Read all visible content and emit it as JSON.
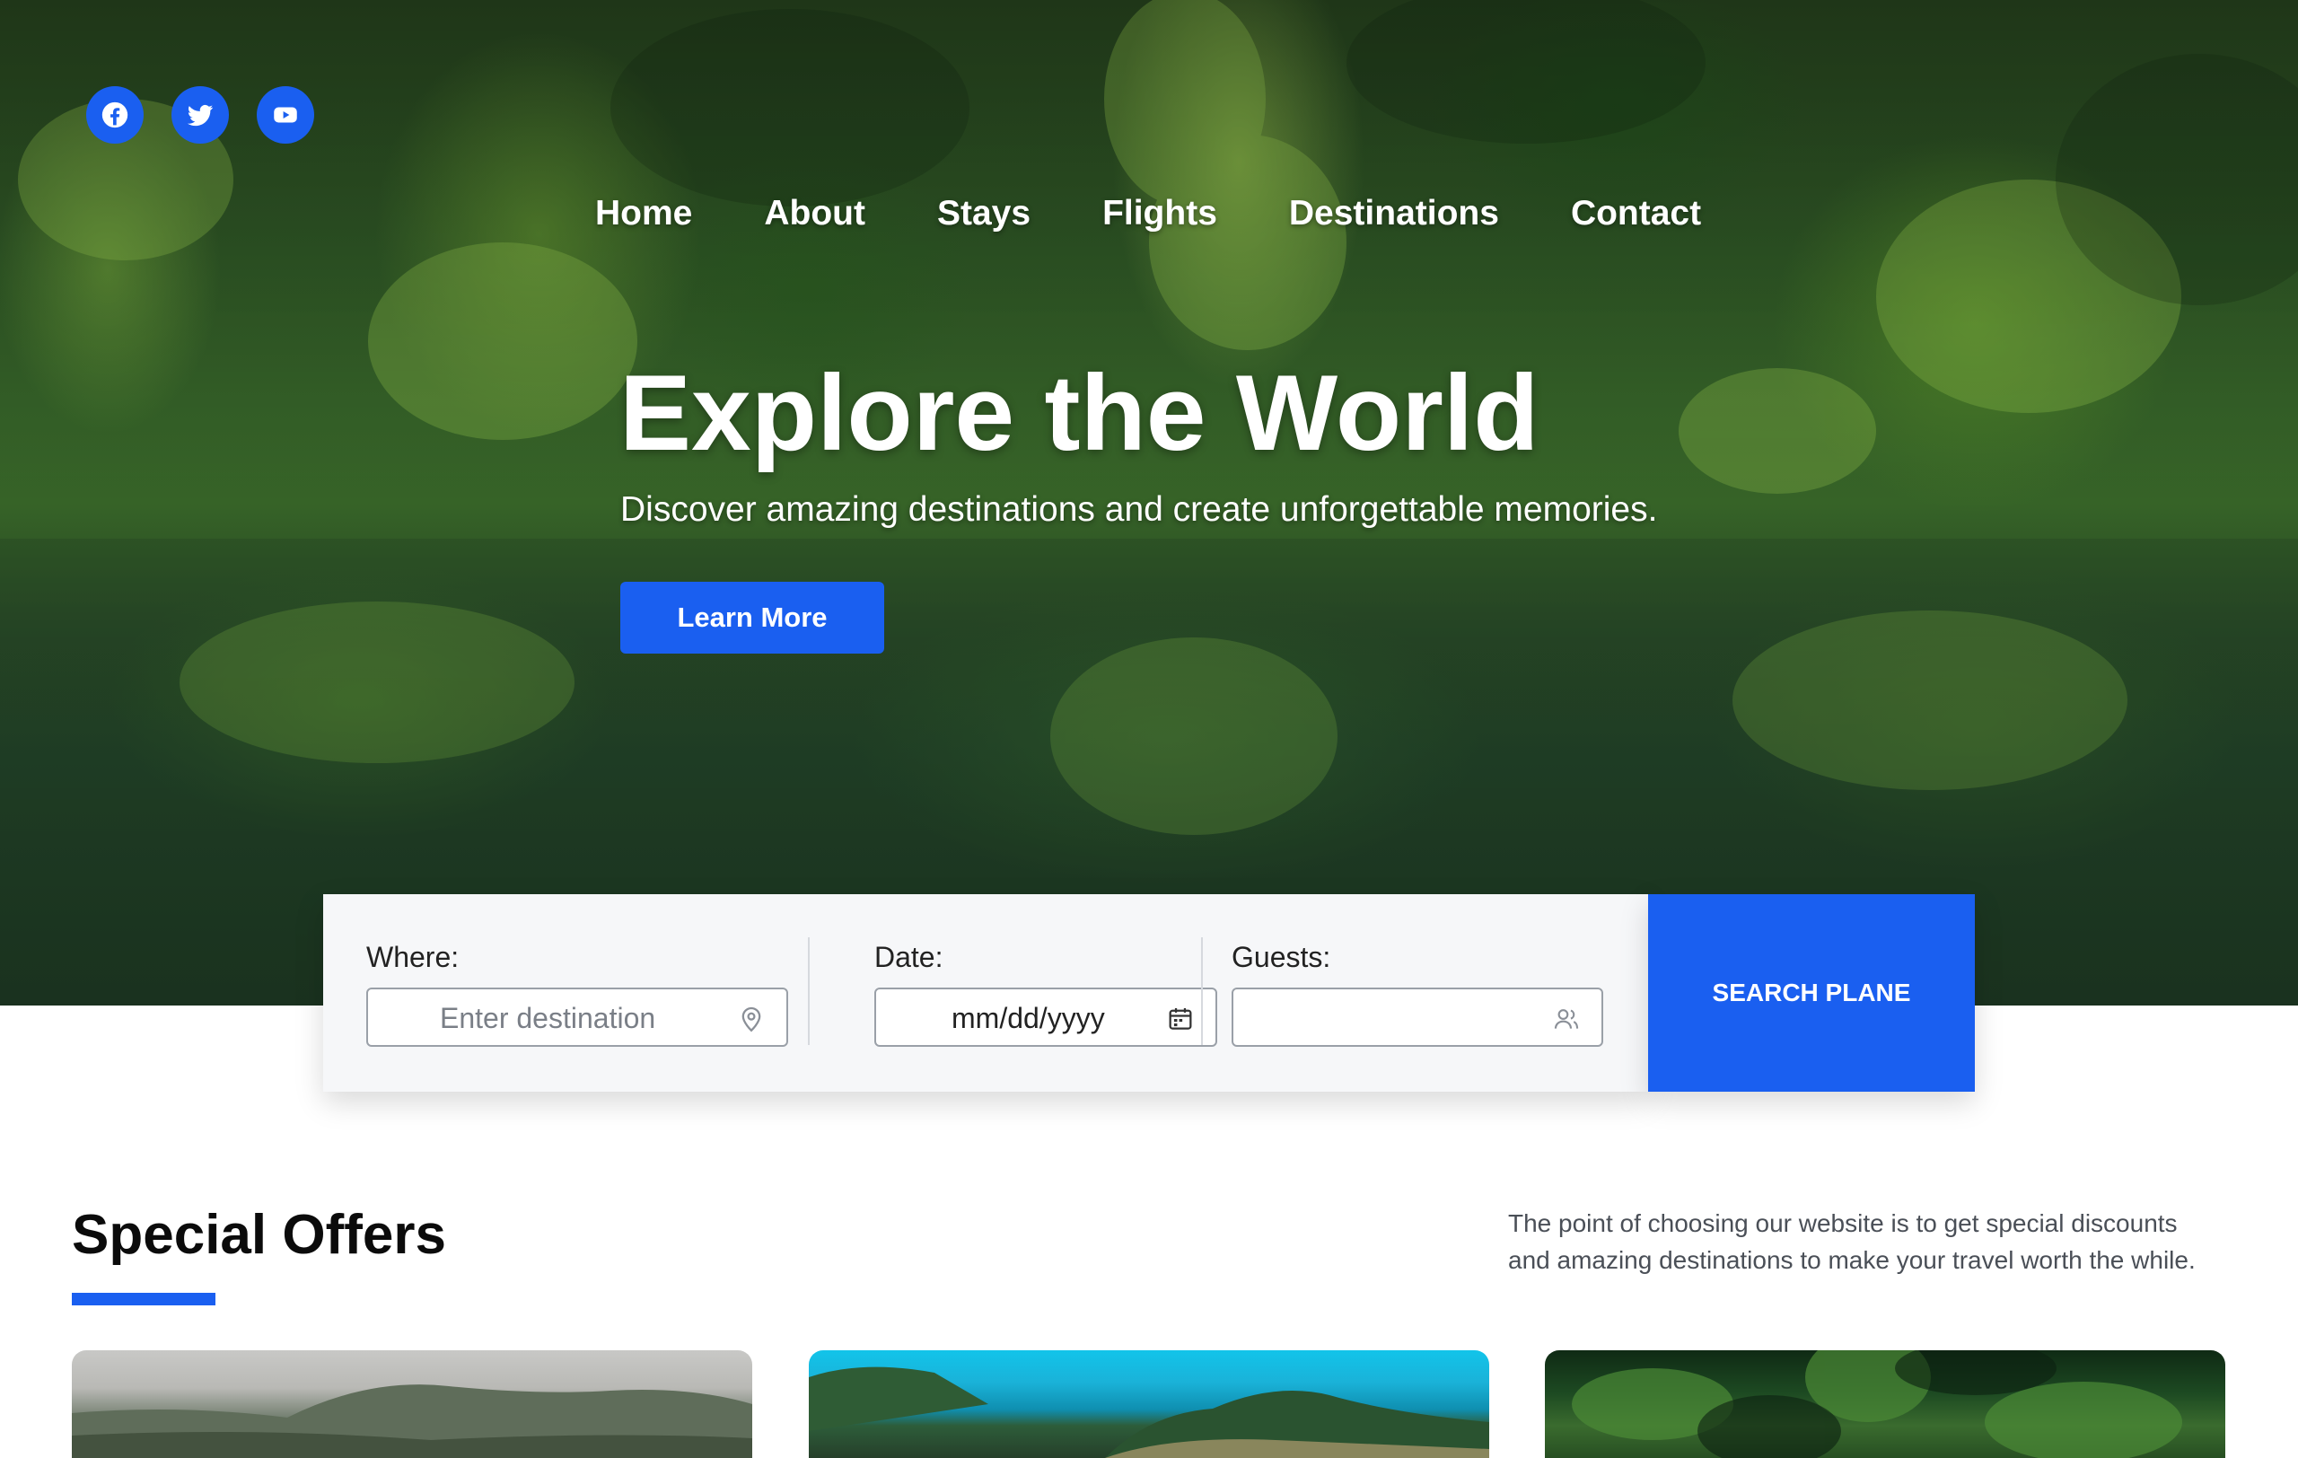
{
  "social": {
    "icons": [
      "facebook-icon",
      "twitter-icon",
      "youtube-icon"
    ],
    "color": "#1a5ff0"
  },
  "nav": {
    "items": [
      "Home",
      "About",
      "Stays",
      "Flights",
      "Destinations",
      "Contact"
    ]
  },
  "hero": {
    "title": "Explore the World",
    "subtitle": "Discover amazing destinations and create unforgettable memories.",
    "cta_label": "Learn More"
  },
  "search": {
    "where_label": "Where:",
    "where_placeholder": "Enter destination",
    "where_icon": "location-pin-icon",
    "date_label": "Date:",
    "date_placeholder": "mm/dd/yyyy",
    "date_icon": "calendar-icon",
    "guests_label": "Guests:",
    "guests_value": "",
    "guests_icon": "users-icon",
    "button_label": "SEARCH PLANE"
  },
  "offers": {
    "title": "Special Offers",
    "description": "The point of choosing our website is to get special discounts and amazing destinations to make your travel worth the while.",
    "accent": "#1a5ff0"
  }
}
